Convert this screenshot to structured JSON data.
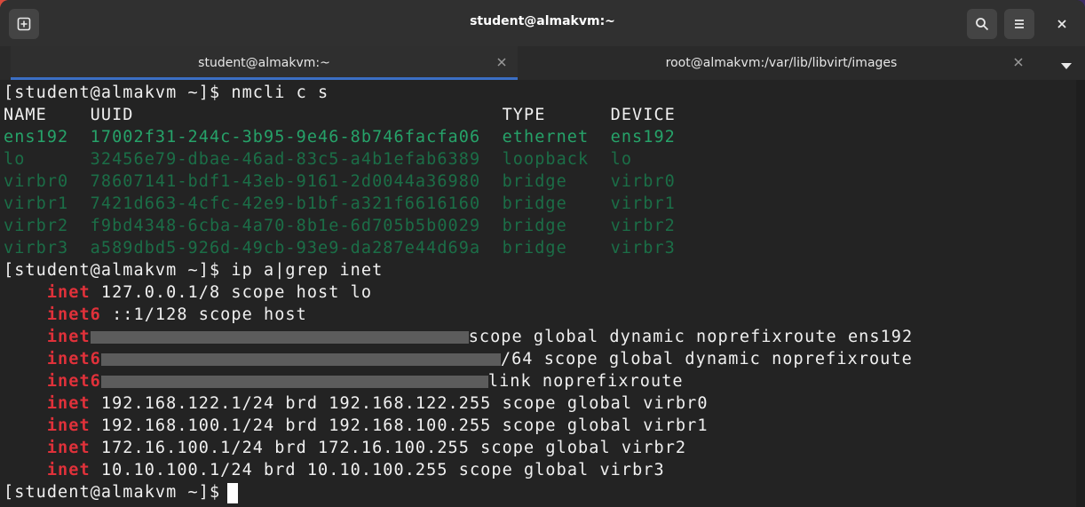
{
  "window": {
    "title": "student@almakvm:~"
  },
  "tabs": [
    {
      "label": "student@almakvm:~",
      "active": true
    },
    {
      "label": "root@almakvm:/var/lib/libvirt/images",
      "active": false
    }
  ],
  "icons": {
    "new_tab": "new-tab-icon",
    "search": "search-icon",
    "menu": "hamburger-menu-icon",
    "close": "close-icon",
    "tab_close": "close-icon",
    "tabs_menu": "chevron-down-icon"
  },
  "colors": {
    "terminal_bg": "#232323",
    "prompt_text": "#f0f0f0",
    "green_bright": "#26a269",
    "green_dim": "#1b6e47",
    "inet_red": "#e0313a",
    "tab_accent": "#3b6fc4"
  },
  "terminal": {
    "prompt": "[student@almakvm ~]$",
    "cmd1": "nmcli c s",
    "nmcli_header": "NAME    UUID                                  TYPE      DEVICE",
    "nmcli_rows": [
      "ens192  17002f31-244c-3b95-9e46-8b746facfa06  ethernet  ens192",
      "lo      32456e79-dbae-46ad-83c5-a4b1efab6389  loopback  lo",
      "virbr0  78607141-bdf1-43eb-9161-2d0044a36980  bridge    virbr0",
      "virbr1  7421d663-4cfc-42e9-b1bf-a321f6616160  bridge    virbr1",
      "virbr2  f9bd4348-6cba-4a70-8b1e-6d705b5b0029  bridge    virbr2",
      "virbr3  a589dbd5-926d-49cb-93e9-da287e44d69a  bridge    virbr3"
    ],
    "cmd2": "ip a|grep inet",
    "inet_lines": [
      {
        "kw": "inet",
        "rest": " 127.0.0.1/8 scope host lo"
      },
      {
        "kw": "inet6",
        "rest": " ::1/128 scope host"
      },
      {
        "kw": "inet",
        "rest": "scope global dynamic noprefixroute ens192"
      },
      {
        "kw": "inet6",
        "rest": "/64 scope global dynamic noprefixroute"
      },
      {
        "kw": "inet6",
        "rest": "link noprefixroute"
      },
      {
        "kw": "inet",
        "rest": " 192.168.122.1/24 brd 192.168.122.255 scope global virbr0"
      },
      {
        "kw": "inet",
        "rest": " 192.168.100.1/24 brd 192.168.100.255 scope global virbr1"
      },
      {
        "kw": "inet",
        "rest": " 172.16.100.1/24 brd 172.16.100.255 scope global virbr2"
      },
      {
        "kw": "inet",
        "rest": " 10.10.100.1/24 brd 10.10.100.255 scope global virbr3"
      }
    ]
  }
}
